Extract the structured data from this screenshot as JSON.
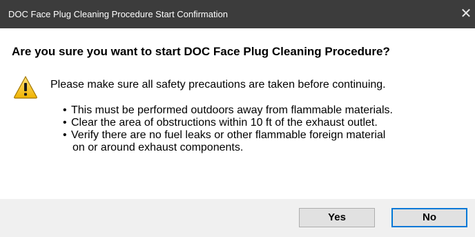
{
  "window": {
    "title": "DOC Face Plug Cleaning Procedure Start Confirmation",
    "close_glyph": "✕"
  },
  "dialog": {
    "heading": "Are you sure you want to start DOC Face Plug Cleaning Procedure?",
    "icon": "warning-icon",
    "message": "Please make sure all safety precautions are taken before continuing.",
    "bullets": [
      "This must be performed outdoors away from flammable materials.",
      "Clear the area of obstructions within 10 ft of the exhaust outlet.",
      "Verify there are no fuel leaks or other flammable foreign material"
    ],
    "bullet_continuation": "on or around exhaust components."
  },
  "buttons": {
    "yes_label": "Yes",
    "no_label": "No"
  },
  "colors": {
    "titlebar": "#3c3c3c",
    "warning": "#f5c518",
    "focus_border": "#0078d7"
  }
}
